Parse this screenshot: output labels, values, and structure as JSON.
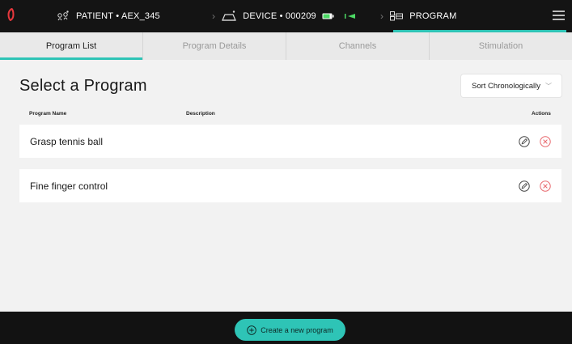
{
  "header": {
    "patient_label": "PATIENT • AEX_345",
    "device_label": "DEVICE • 000209",
    "program_label": "PROGRAM",
    "icons": [
      "logo-icon",
      "patient-icon",
      "device-icon",
      "battery-icon",
      "signal-icon",
      "program-icon",
      "menu-icon"
    ],
    "colors": {
      "accent": "#2ec4b6",
      "logo": "#e8383d",
      "battery": "#4cd964"
    }
  },
  "tabs": [
    {
      "label": "Program List",
      "active": true
    },
    {
      "label": "Program Details",
      "active": false
    },
    {
      "label": "Channels",
      "active": false
    },
    {
      "label": "Stimulation",
      "active": false
    }
  ],
  "main": {
    "title": "Select a Program",
    "sort_label": "Sort Chronologically",
    "columns": {
      "name": "Program Name",
      "description": "Description",
      "actions": "Actions"
    },
    "programs": [
      {
        "name": "Grasp tennis ball",
        "description": ""
      },
      {
        "name": "Fine finger control",
        "description": ""
      }
    ]
  },
  "footer": {
    "create_label": "Create a new program"
  }
}
